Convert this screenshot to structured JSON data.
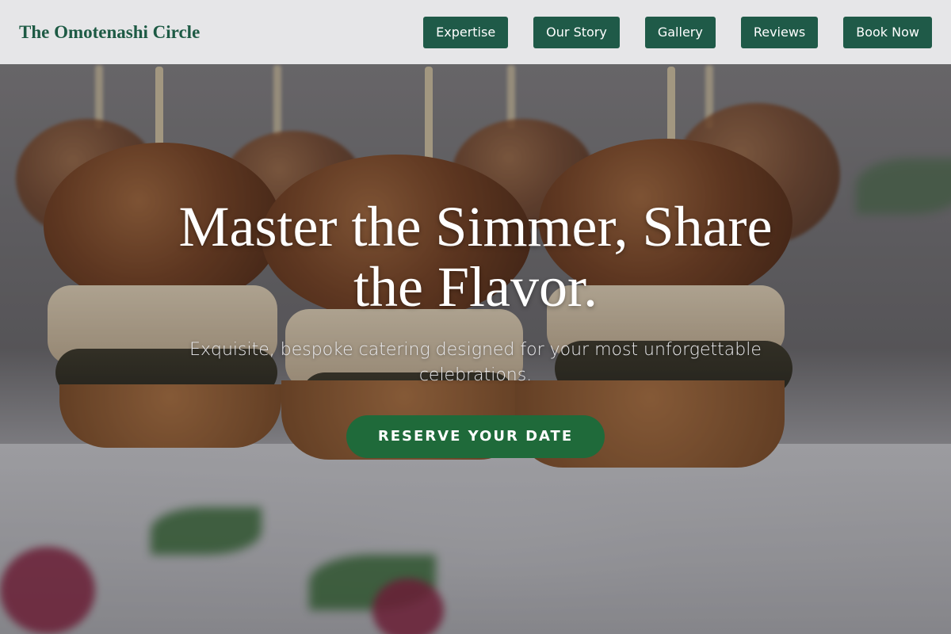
{
  "brand": {
    "name": "The Omotenashi Circle"
  },
  "nav": {
    "items": [
      {
        "label": "Expertise"
      },
      {
        "label": "Our Story"
      },
      {
        "label": "Gallery"
      },
      {
        "label": "Reviews"
      },
      {
        "label": "Book Now"
      }
    ]
  },
  "hero": {
    "headline": "Master the Simmer, Share the Flavor.",
    "subheadline": "Exquisite, bespoke catering designed for your most unforgettable celebrations.",
    "cta_label": "RESERVE YOUR DATE",
    "background_image": "sliders-on-plate-photo"
  },
  "colors": {
    "brand_green": "#1d5a44",
    "nav_button": "#1f5a48",
    "cta_green": "#1f6a3a"
  }
}
